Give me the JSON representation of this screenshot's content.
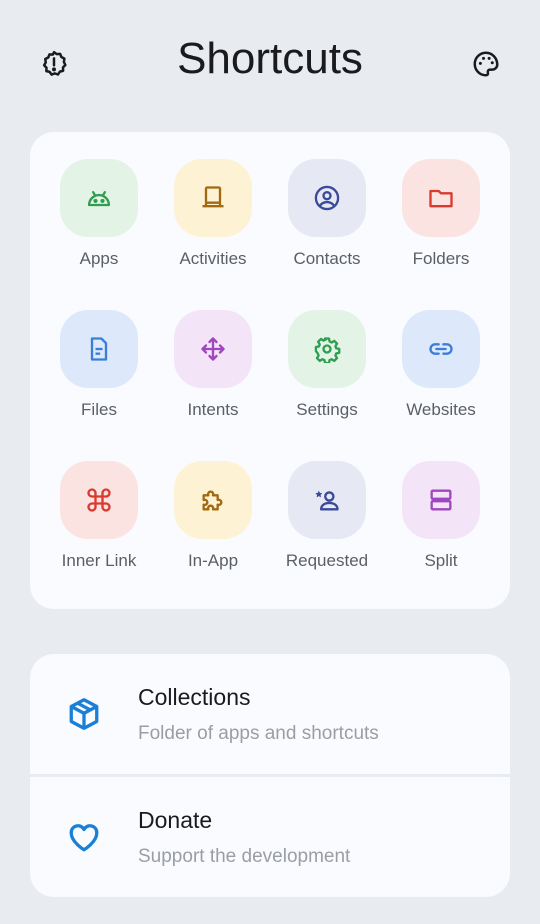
{
  "header": {
    "title": "Shortcuts",
    "left_icon": "settings-badge-icon",
    "right_icon": "palette-icon"
  },
  "grid": {
    "items": [
      {
        "label": "Apps",
        "icon": "android-icon",
        "bg": "#e3f3e6",
        "fg": "#2e9e4f"
      },
      {
        "label": "Activities",
        "icon": "activity-icon",
        "bg": "#fdf2d4",
        "fg": "#a16a10"
      },
      {
        "label": "Contacts",
        "icon": "contact-icon",
        "bg": "#e6e8f4",
        "fg": "#3a4a9a"
      },
      {
        "label": "Folders",
        "icon": "folder-icon",
        "bg": "#fbe3e1",
        "fg": "#d83b2e"
      },
      {
        "label": "Files",
        "icon": "file-icon",
        "bg": "#dde9fb",
        "fg": "#3b7ed8"
      },
      {
        "label": "Intents",
        "icon": "move-arrows-icon",
        "bg": "#f3e4f8",
        "fg": "#a046c0"
      },
      {
        "label": "Settings",
        "icon": "gear-icon",
        "bg": "#e3f3e6",
        "fg": "#2e9e4f"
      },
      {
        "label": "Websites",
        "icon": "link-icon",
        "bg": "#dde9fb",
        "fg": "#3b7ed8"
      },
      {
        "label": "Inner Link",
        "icon": "command-icon",
        "bg": "#fbe3e1",
        "fg": "#d83b2e"
      },
      {
        "label": "In-App",
        "icon": "puzzle-icon",
        "bg": "#fdf2d4",
        "fg": "#a16a10"
      },
      {
        "label": "Requested",
        "icon": "person-star-icon",
        "bg": "#e6e8f4",
        "fg": "#3a4a9a"
      },
      {
        "label": "Split",
        "icon": "split-icon",
        "bg": "#f3e4f8",
        "fg": "#a046c0"
      }
    ]
  },
  "list": {
    "items": [
      {
        "title": "Collections",
        "subtitle": "Folder of apps and shortcuts",
        "icon": "box-icon",
        "fg": "#1a7fd6"
      },
      {
        "title": "Donate",
        "subtitle": "Support the development",
        "icon": "heart-icon",
        "fg": "#1a7fd6"
      }
    ]
  }
}
